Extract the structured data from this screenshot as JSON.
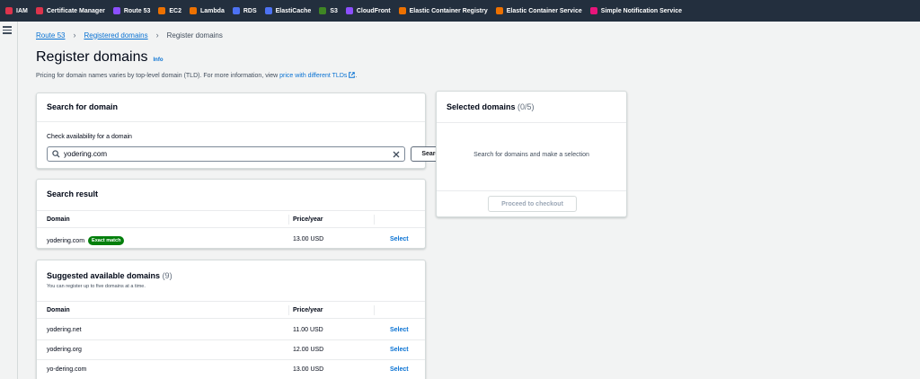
{
  "nav": {
    "services": [
      {
        "label": "IAM",
        "color": "#dd344c"
      },
      {
        "label": "Certificate Manager",
        "color": "#dd344c"
      },
      {
        "label": "Route 53",
        "color": "#8c4fff"
      },
      {
        "label": "EC2",
        "color": "#ed7100"
      },
      {
        "label": "Lambda",
        "color": "#ed7100"
      },
      {
        "label": "RDS",
        "color": "#4d72f3"
      },
      {
        "label": "ElastiCache",
        "color": "#4d72f3"
      },
      {
        "label": "S3",
        "color": "#3f8624"
      },
      {
        "label": "CloudFront",
        "color": "#8c4fff"
      },
      {
        "label": "Elastic Container Registry",
        "color": "#ed7100"
      },
      {
        "label": "Elastic Container Service",
        "color": "#ed7100"
      },
      {
        "label": "Simple Notification Service",
        "color": "#e7157b"
      }
    ]
  },
  "breadcrumb": {
    "items": [
      "Route 53",
      "Registered domains"
    ],
    "current": "Register domains"
  },
  "page": {
    "title": "Register domains",
    "info": "Info",
    "description_prefix": "Pricing for domain names varies by top-level domain (TLD). For more information, view ",
    "description_link": "price with different TLDs",
    "description_suffix": "."
  },
  "search": {
    "header": "Search for domain",
    "label": "Check availability for a domain",
    "value": "yodering.com",
    "button": "Search"
  },
  "result": {
    "header": "Search result",
    "col_domain": "Domain",
    "col_price": "Price/year",
    "rows": [
      {
        "domain": "yodering.com",
        "badge": "Exact match",
        "price": "13.00 USD",
        "action": "Select"
      }
    ]
  },
  "suggested": {
    "header": "Suggested available domains",
    "count": "(9)",
    "subtitle": "You can register up to five domains at a time.",
    "col_domain": "Domain",
    "col_price": "Price/year",
    "rows": [
      {
        "domain": "yodering.net",
        "price": "11.00 USD",
        "action": "Select"
      },
      {
        "domain": "yodering.org",
        "price": "12.00 USD",
        "action": "Select"
      },
      {
        "domain": "yo-dering.com",
        "price": "13.00 USD",
        "action": "Select"
      }
    ]
  },
  "selected": {
    "header": "Selected domains",
    "count": "(0/5)",
    "empty_message": "Search for domains and make a selection",
    "checkout": "Proceed to checkout"
  }
}
